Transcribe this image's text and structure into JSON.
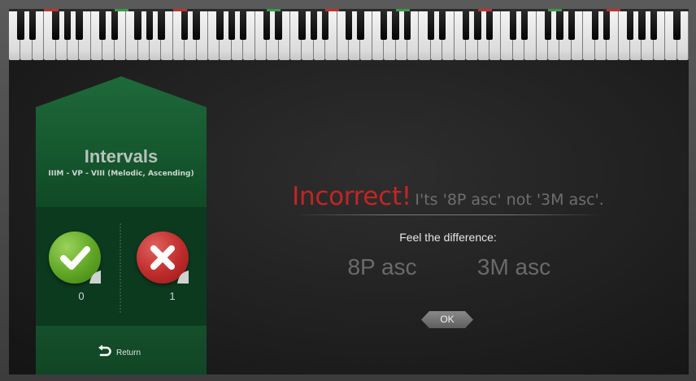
{
  "panel": {
    "title": "Intervals",
    "subtitle": "IIIM - VP - VIII (Melodic, Ascending)",
    "correct_count": "0",
    "incorrect_count": "1",
    "return_label": "Return"
  },
  "feedback": {
    "verdict": "Incorrect!",
    "explanation": "I'ts '8P asc' not '3M asc'.",
    "prompt": "Feel the difference:",
    "interval_a": "8P asc",
    "interval_b": "3M asc",
    "ok_label": "OK"
  },
  "colors": {
    "panel_green": "#0f4a26",
    "incorrect_red": "#c42424",
    "correct_badge": "#5fa524",
    "incorrect_badge": "#bf2b2b",
    "key_marker_red": "#c43030",
    "key_marker_green": "#3a9a4a"
  },
  "icons": {
    "correct": "checkmark-icon",
    "incorrect": "cross-icon",
    "return": "return-arrow-icon"
  }
}
